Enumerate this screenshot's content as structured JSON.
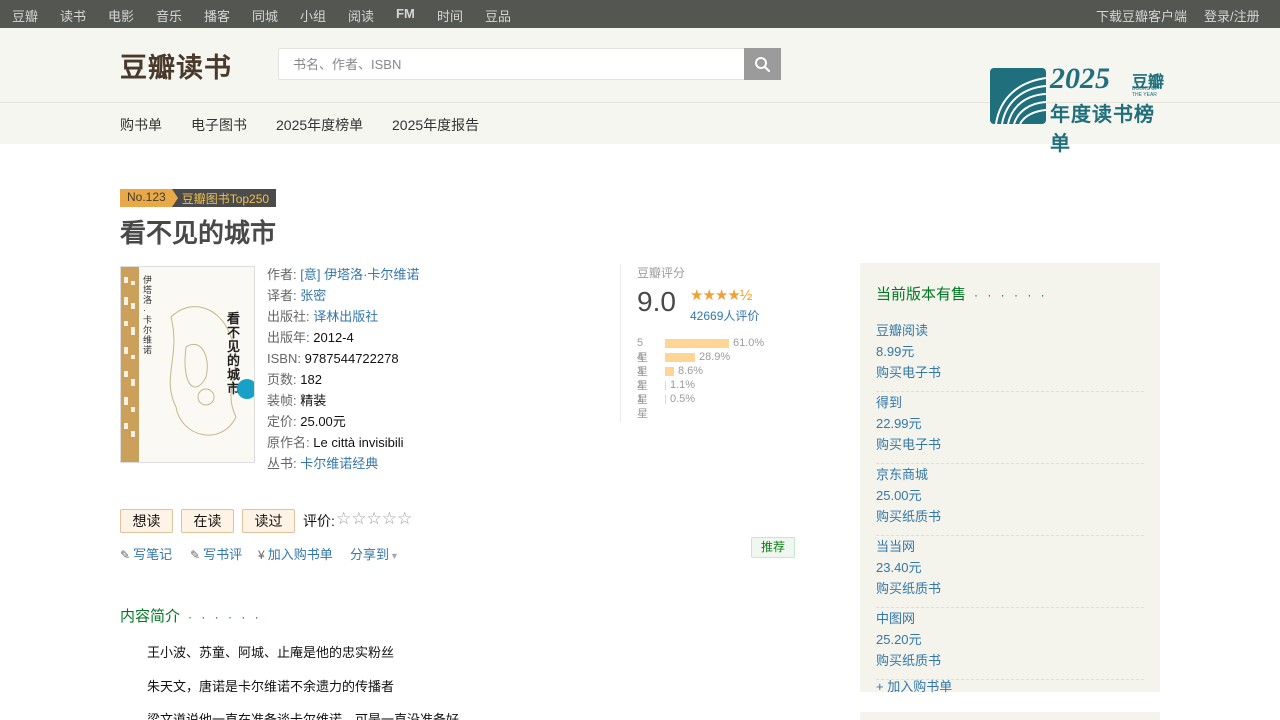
{
  "topnav": {
    "left": [
      "豆瓣",
      "读书",
      "电影",
      "音乐",
      "播客",
      "同城",
      "小组",
      "阅读",
      "FM",
      "时间",
      "豆品"
    ],
    "download": "下载豆瓣客户端",
    "login": "登录/注册"
  },
  "header": {
    "logo": "豆瓣读书",
    "search_placeholder": "书名、作者、ISBN",
    "subnav": [
      "购书单",
      "电子图书",
      "2025年度榜单",
      "2025年度报告"
    ],
    "annual": {
      "year": "2025",
      "brand": "豆瓣",
      "sub": "BOOKS OF THE YEAR",
      "title": "年度读书榜单"
    }
  },
  "book": {
    "rank_no": "No.123",
    "rank_list": "豆瓣图书Top250",
    "title": "看不见的城市",
    "cover": {
      "title": "看不见的城市",
      "author": "伊塔洛·卡尔维诺"
    },
    "info": {
      "author_label": "作者:",
      "author": "[意] 伊塔洛·卡尔维诺",
      "translator_label": "译者:",
      "translator": "张密",
      "publisher_label": "出版社:",
      "publisher": "译林出版社",
      "year_label": "出版年:",
      "year": "2012-4",
      "isbn_label": "ISBN:",
      "isbn": "9787544722278",
      "pages_label": "页数:",
      "pages": "182",
      "binding_label": "装帧:",
      "binding": "精装",
      "price_label": "定价:",
      "price": "25.00元",
      "original_label": "原作名:",
      "original": "Le città invisibili",
      "series_label": "丛书:",
      "series": "卡尔维诺经典"
    }
  },
  "rating": {
    "title": "豆瓣评分",
    "score": "9.0",
    "stars": "★★★★½",
    "count": "42669人评价",
    "dist": [
      {
        "label": "5星",
        "pct": "61.0%",
        "value": 61.0
      },
      {
        "label": "4星",
        "pct": "28.9%",
        "value": 28.9
      },
      {
        "label": "3星",
        "pct": "8.6%",
        "value": 8.6
      },
      {
        "label": "2星",
        "pct": "1.1%",
        "value": 1.1
      },
      {
        "label": "1星",
        "pct": "0.5%",
        "value": 0.5
      }
    ]
  },
  "actions": {
    "want": "想读",
    "reading": "在读",
    "read": "读过",
    "rate_label": "评价:",
    "note": "写笔记",
    "review": "写书评",
    "cart": "加入购书单",
    "share": "分享到",
    "recommend": "推荐"
  },
  "intro": {
    "heading": "内容简介",
    "dots": "· · · · · ·",
    "lines": [
      "王小波、苏童、阿城、止庵是他的忠实粉丝",
      "朱天文，唐诺是卡尔维诺不余遗力的传播者",
      "梁文道说他一直在准备谈卡尔维诺，可是一直没准备好"
    ]
  },
  "aside": {
    "heading": "当前版本有售",
    "dots": "· · · · · ·",
    "vendors": [
      {
        "name": "豆瓣阅读",
        "price": "8.99元",
        "buy": "购买电子书"
      },
      {
        "name": "得到",
        "price": "22.99元",
        "buy": "购买电子书"
      },
      {
        "name": "京东商城",
        "price": "25.00元",
        "buy": "购买纸质书"
      },
      {
        "name": "当当网",
        "price": "23.40元",
        "buy": "购买纸质书"
      },
      {
        "name": "中图网",
        "price": "25.20元",
        "buy": "购买纸质书"
      }
    ],
    "add": "+ 加入购书单"
  }
}
